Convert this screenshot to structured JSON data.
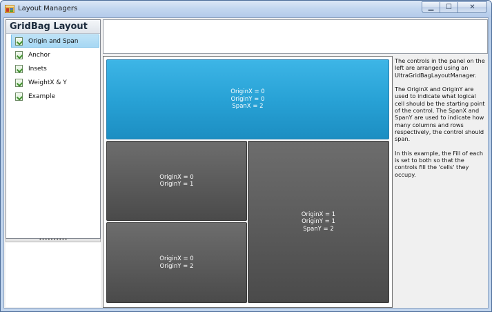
{
  "window": {
    "title": "Layout Managers",
    "caption_buttons": {
      "minimize": "▁",
      "maximize": "☐",
      "close": "✕"
    }
  },
  "sidebar": {
    "header": "GridBag Layout",
    "items": [
      {
        "label": "Origin and Span",
        "selected": true,
        "icon": "checkmark-doc-icon"
      },
      {
        "label": "Anchor",
        "selected": false,
        "icon": "checkmark-doc-icon"
      },
      {
        "label": "Insets",
        "selected": false,
        "icon": "checkmark-doc-icon"
      },
      {
        "label": "WeightX & Y",
        "selected": false,
        "icon": "checkmark-doc-icon"
      },
      {
        "label": "Example",
        "selected": false,
        "icon": "checkmark-doc-icon"
      }
    ],
    "splitter_grip": "••••••••••"
  },
  "demo": {
    "cells": [
      {
        "text": "OriginX = 0\nOriginY = 0\nSpanX = 2",
        "color": "#29a3d8"
      },
      {
        "text": "OriginX = 0\nOriginY = 1",
        "color": "#5a5a5a"
      },
      {
        "text": "OriginX = 0\nOriginY = 2",
        "color": "#5a5a5a"
      },
      {
        "text": "OriginX = 1\nOriginY = 1\nSpanY = 2",
        "color": "#5a5a5a"
      }
    ]
  },
  "description": {
    "paragraphs": [
      "The controls in the panel on the left are arranged using an UltraGridBagLayoutManager.",
      "The OriginX and OriginY are used to indicate what logical cell should be the starting point of the control. The SpanX and SpanY are used to indicate how many columns and rows respectively, the control should span.",
      "In this example, the Fill of each is set to both so that the controls fill the 'cells' they occupy."
    ]
  }
}
